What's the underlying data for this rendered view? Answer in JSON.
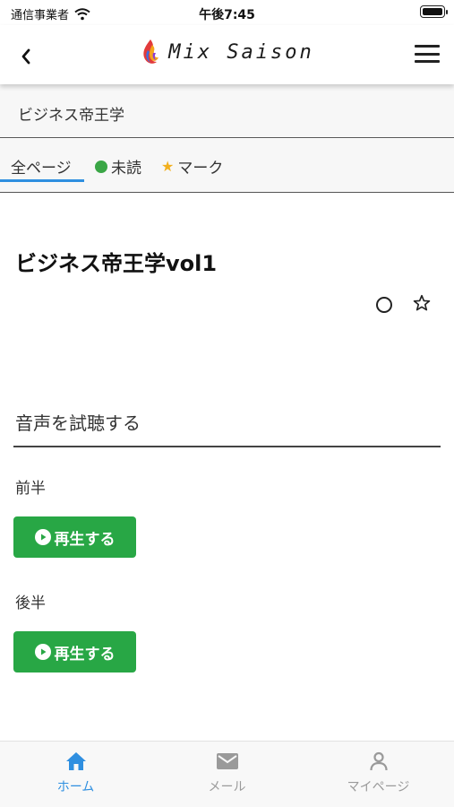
{
  "status_bar": {
    "carrier": "通信事業者",
    "time": "午後7:45"
  },
  "header": {
    "logo_text": "Mix Saison"
  },
  "breadcrumb": {
    "text": "ビジネス帝王学"
  },
  "tabs": [
    {
      "label": "全ページ",
      "icon": ""
    },
    {
      "label": "未読",
      "icon": "green-dot-icon"
    },
    {
      "label": "マーク",
      "icon": "star-icon"
    }
  ],
  "content": {
    "title": "ビジネス帝王学vol1",
    "section_title": "音声を試聴する",
    "parts": [
      {
        "label": "前半",
        "button": "再生する"
      },
      {
        "label": "後半",
        "button": "再生する"
      }
    ]
  },
  "bottom_nav": [
    {
      "label": "ホーム",
      "icon": "home-icon"
    },
    {
      "label": "メール",
      "icon": "mail-icon"
    },
    {
      "label": "マイページ",
      "icon": "person-icon"
    }
  ],
  "colors": {
    "accent": "#2f8fe0",
    "play_button": "#28a745",
    "unread_dot": "#3aa646",
    "mark_star": "#f2b01e"
  }
}
